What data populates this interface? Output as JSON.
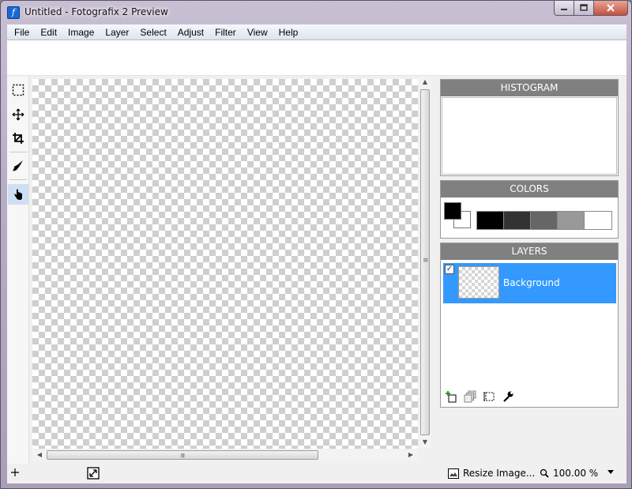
{
  "window": {
    "title": "Untitled - Fotografix 2 Preview",
    "app_icon_glyph": "f",
    "buttons": [
      "minimize-icon",
      "maximize-icon",
      "close-icon"
    ]
  },
  "menu": {
    "items": [
      "File",
      "Edit",
      "Image",
      "Layer",
      "Select",
      "Adjust",
      "Filter",
      "View",
      "Help"
    ]
  },
  "tools": [
    {
      "name": "rectangle-select-icon",
      "active": false
    },
    {
      "name": "move-icon",
      "active": false
    },
    {
      "name": "crop-icon",
      "active": false
    },
    {
      "name": "paint-brush-icon",
      "active": false
    },
    {
      "name": "hand-pan-icon",
      "active": true
    }
  ],
  "panels": {
    "histogram": {
      "title": "HISTOGRAM"
    },
    "colors": {
      "title": "COLORS",
      "primary": "#000000",
      "secondary": "#ffffff",
      "palette": [
        "#000000",
        "#333333",
        "#666666",
        "#999999",
        "#ffffff"
      ]
    },
    "layers": {
      "title": "LAYERS",
      "items": [
        {
          "name": "Background",
          "visible": true,
          "selected": true
        }
      ],
      "tool_icons": [
        "add-layer-icon",
        "duplicate-layer-icon",
        "layer-properties-icon",
        "layer-settings-icon"
      ]
    }
  },
  "status": {
    "resize_label": "Resize Image...",
    "zoom": "100.00 %"
  },
  "colors": {
    "selection": "#3399ff",
    "panel_header": "#808080"
  }
}
